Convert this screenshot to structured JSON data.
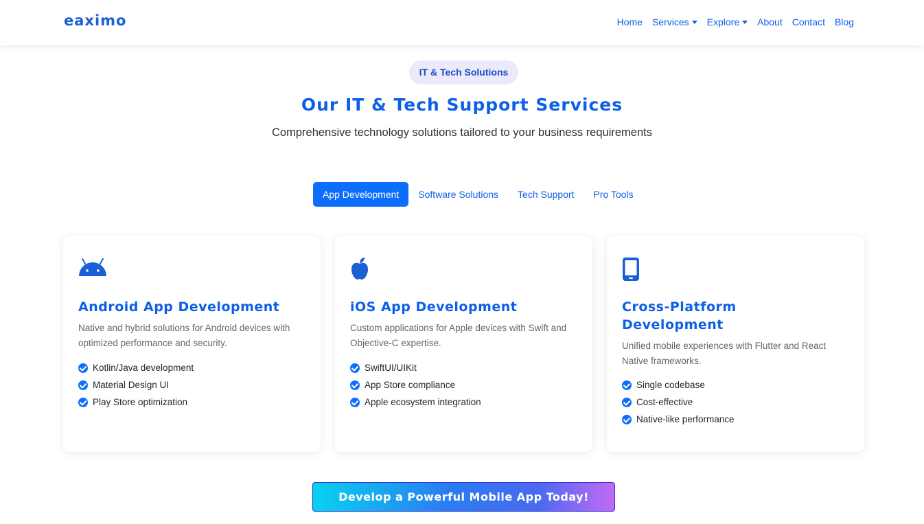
{
  "brand": {
    "name": "eaximo",
    "color": "#1a5fd6"
  },
  "nav": {
    "items": [
      {
        "label": "Home",
        "dropdown": false
      },
      {
        "label": "Services",
        "dropdown": true
      },
      {
        "label": "Explore",
        "dropdown": true
      },
      {
        "label": "About",
        "dropdown": false
      },
      {
        "label": "Contact",
        "dropdown": false
      },
      {
        "label": "Blog",
        "dropdown": false
      }
    ]
  },
  "hero": {
    "badge": "IT & Tech Solutions",
    "title": "Our IT & Tech Support Services",
    "subtitle": "Comprehensive technology solutions tailored to your business requirements"
  },
  "tabs": {
    "items": [
      {
        "label": "App Development",
        "active": true
      },
      {
        "label": "Software Solutions",
        "active": false
      },
      {
        "label": "Tech Support",
        "active": false
      },
      {
        "label": "Pro Tools",
        "active": false
      }
    ]
  },
  "cards": [
    {
      "icon": "android-icon",
      "title": "Android App Development",
      "description": "Native and hybrid solutions for Android devices with optimized performance and security.",
      "features": [
        "Kotlin/Java development",
        "Material Design UI",
        "Play Store optimization"
      ]
    },
    {
      "icon": "apple-icon",
      "title": "iOS App Development",
      "description": "Custom applications for Apple devices with Swift and Objective-C expertise.",
      "features": [
        "SwiftUI/UIKit",
        "App Store compliance",
        "Apple ecosystem integration"
      ]
    },
    {
      "icon": "mobile-phone-icon",
      "title": "Cross-Platform Development",
      "description": "Unified mobile experiences with Flutter and React Native frameworks.",
      "features": [
        "Single codebase",
        "Cost-effective",
        "Native-like performance"
      ]
    }
  ],
  "cta": {
    "label": "Develop a Powerful Mobile App Today!"
  },
  "colors": {
    "primary": "#0d6efd",
    "heading": "#0d5fe8",
    "badge_bg": "#ece9fb",
    "cta_gradient_start": "#06d2f0",
    "cta_gradient_end": "#c46af5"
  }
}
